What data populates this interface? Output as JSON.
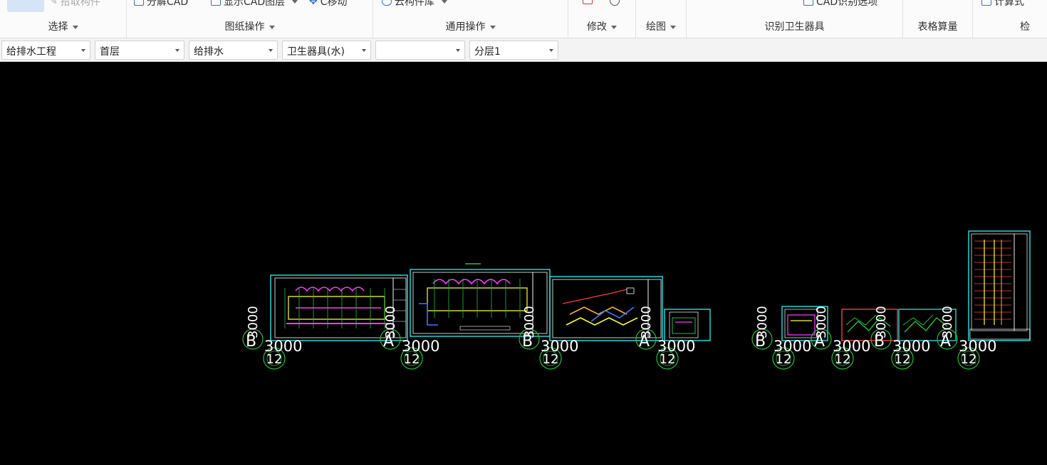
{
  "ribbon": {
    "groups": {
      "select": {
        "caption": "选择",
        "pick_label": "拾取构件"
      },
      "drawing_ops": {
        "caption": "图纸操作",
        "explode_label": "分解CAD",
        "show_layers_label": "显示CAD图层",
        "move_label": "C移动"
      },
      "common_ops": {
        "caption": "通用操作",
        "cloud_lib_label": "云构件库"
      },
      "modify": {
        "caption": "修改"
      },
      "draw": {
        "caption": "绘图"
      },
      "identify": {
        "caption": "识别卫生器具",
        "cad_options_label": "CAD识别选项"
      },
      "table_calc": {
        "caption": "表格算量"
      },
      "check": {
        "caption": "检",
        "formula_label": "计算式"
      }
    }
  },
  "combobar": {
    "project": "给排水工程",
    "floor": "首层",
    "discipline": "给排水",
    "component_type": "卫生器具(水)",
    "component": "",
    "layer": "分层1"
  },
  "canvas": {
    "axis_labels": [
      "B",
      "A",
      "B",
      "A",
      "B",
      "A",
      "B",
      "A"
    ],
    "dimension_label": "3000",
    "axis_number": "12",
    "colors": {
      "background": "#000000",
      "frame": "#22d4d4",
      "axis": "#1fbf3a",
      "text": "#ffffff",
      "wall": "#ffff33",
      "pipe": "#ff3aff"
    }
  }
}
